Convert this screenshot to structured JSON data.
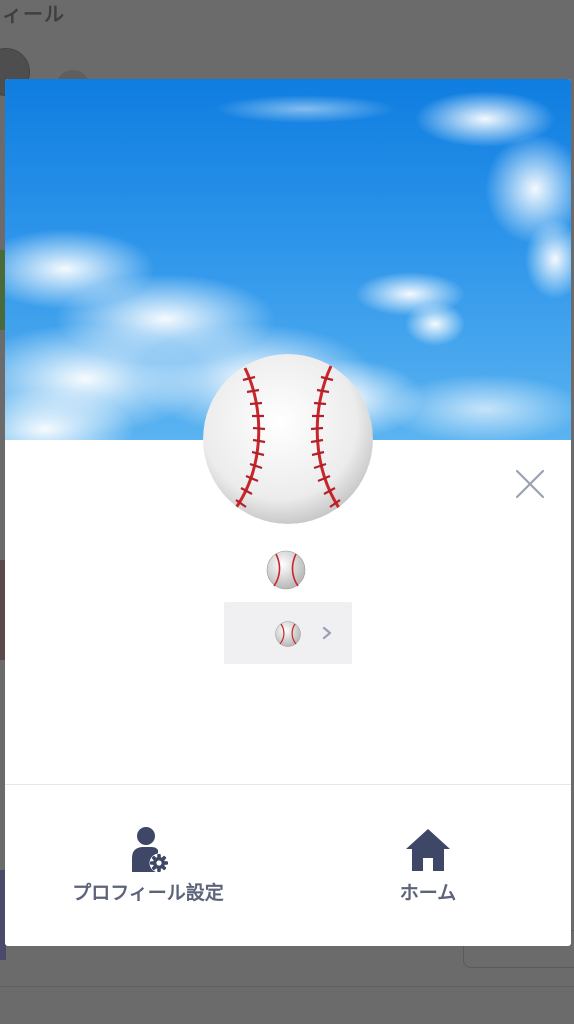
{
  "background": {
    "title": "ィール"
  },
  "profile": {
    "cover_style": "blue sky with clouds",
    "avatar": "baseball",
    "name_icon": "baseball",
    "status_icon": "baseball"
  },
  "actions": {
    "profile_settings_label": "プロフィール設定",
    "home_label": "ホーム"
  },
  "icons": {
    "close": "close-icon",
    "profile_settings": "person-gear-icon",
    "home": "home-icon",
    "chevron": "chevron-right-icon"
  },
  "colors": {
    "action_text": "#5d6479",
    "icon": "#3f4766",
    "close": "#9aa1b3",
    "sky": "#1a86e4"
  }
}
